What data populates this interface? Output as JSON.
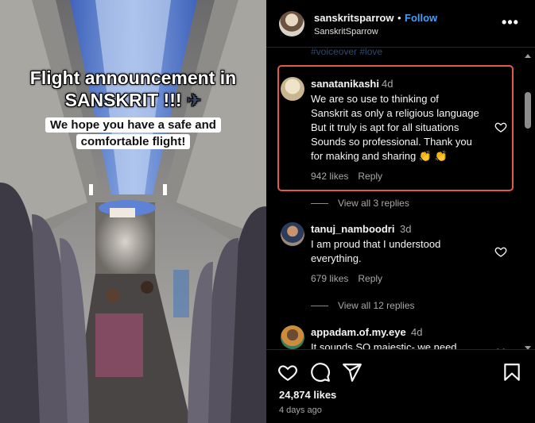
{
  "post": {
    "overlay_title_line1": "Flight announcement in",
    "overlay_title_line2": "SANSKRIT !!!",
    "overlay_title_emoji": "✈",
    "overlay_subtitle_line1": "We hope you have a safe and",
    "overlay_subtitle_line2": "comfortable flight!",
    "sign_text": "⬚ ⬚"
  },
  "header": {
    "username": "sanskritsparrow",
    "separator": "•",
    "follow_label": "Follow",
    "subtitle": "SanskritSparrow",
    "more_label": "•••"
  },
  "comments": {
    "hashtags": "#voiceover #love",
    "items": [
      {
        "username": "sanatanikashi",
        "time": "4d",
        "lines": [
          "We are so use to thinking of",
          "Sanskrit as only a religious language",
          "But it truly is apt for all situations",
          "Sounds so professional. Thank you",
          "for making and sharing 👏 👏"
        ],
        "likes": "942 likes",
        "reply_label": "Reply",
        "view_replies": "View all 3 replies"
      },
      {
        "username": "tanuj_namboodri",
        "time": "3d",
        "lines": [
          "I am proud that I understood",
          "everything."
        ],
        "likes": "679 likes",
        "reply_label": "Reply",
        "view_replies": "View all 12 replies"
      },
      {
        "username": "appadam.of.my.eye",
        "time": "4d",
        "lines": [
          "It sounds SO majestic- we need"
        ]
      }
    ]
  },
  "actions": {
    "like_icon": "heart-icon",
    "comment_icon": "comment-icon",
    "share_icon": "share-icon",
    "save_icon": "bookmark-icon",
    "likes_count": "24,874 likes",
    "posted_ago": "4 days ago"
  },
  "colors": {
    "follow": "#4a9ff5",
    "highlight_border": "#e05a52",
    "muted_text": "#a8a8a8"
  }
}
